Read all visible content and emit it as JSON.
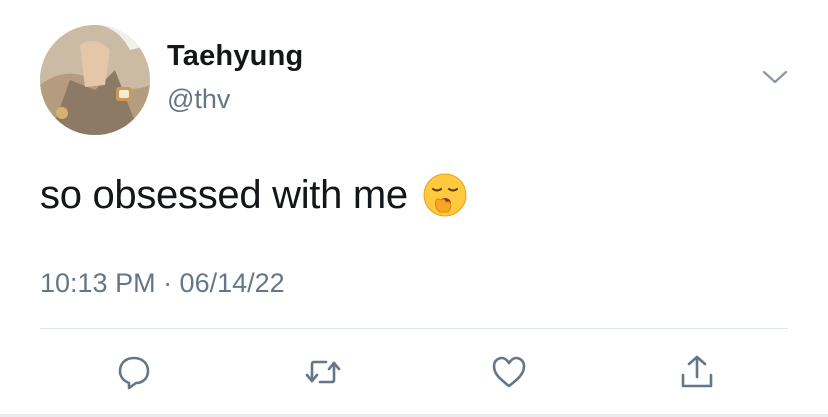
{
  "user": {
    "display_name": "Taehyung",
    "handle": "@thv"
  },
  "tweet": {
    "text": "so obsessed with me",
    "emoji": "yawning-face-emoji",
    "timestamp": "10:13 PM · 06/14/22"
  },
  "actions": {
    "reply": "reply-icon",
    "retweet": "retweet-icon",
    "like": "heart-icon",
    "share": "share-icon"
  },
  "colors": {
    "primary_text": "#14171a",
    "secondary_text": "#657786",
    "icon": "#657786",
    "divider": "#e1e8ed"
  }
}
